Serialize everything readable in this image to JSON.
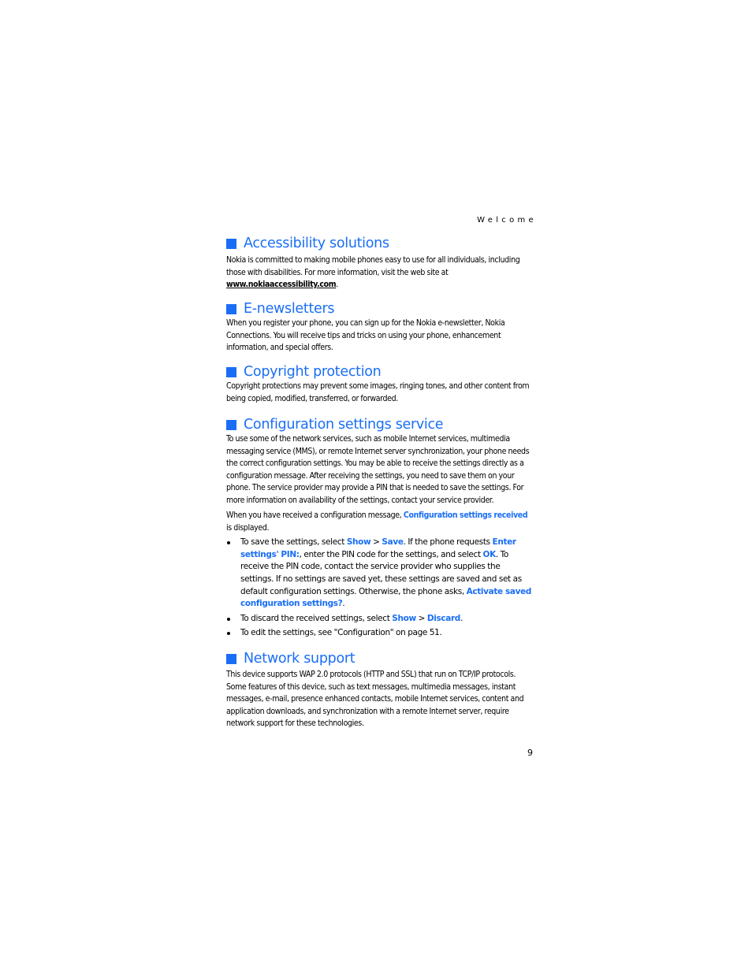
{
  "header": {
    "running_title": "Welcome"
  },
  "accent_color": "#1a6ef5",
  "icons": {
    "section_marker": "blue-square-icon",
    "bullet": "bullet-dot-icon"
  },
  "sections": {
    "accessibility": {
      "title": "Accessibility solutions",
      "text_before_link": "Nokia is committed to making mobile phones easy to use for all individuals, including those with disabilities. For more information, visit the web site at ",
      "link": "www.nokiaaccessibility.com",
      "text_after_link": "."
    },
    "enewsletters": {
      "title": "E-newsletters",
      "text": "When you register your phone, you can sign up for the Nokia e-newsletter, Nokia Connections. You will receive tips and tricks on using your phone, enhancement information, and special offers."
    },
    "copyright": {
      "title": "Copyright protection",
      "text": "Copyright protections may prevent some images, ringing tones, and other content from being copied, modified, transferred, or forwarded."
    },
    "configuration": {
      "title": "Configuration settings service",
      "para1": "To use some of the network services, such as mobile Internet services, multimedia messaging service (MMS), or remote Internet server synchronization, your phone needs the correct configuration settings. You may be able to receive the settings directly as a configuration message. After receiving the settings, you need to save them on your phone. The service provider may provide a PIN that is needed to save the settings. For more information on availability of the settings, contact your service provider.",
      "para2": {
        "before": "When you have received a configuration message, ",
        "highlight": "Configuration settings received",
        "after": " is displayed."
      },
      "bullets": [
        {
          "t1": "To save the settings, select ",
          "k1": "Show",
          "t2": " > ",
          "k2": "Save",
          "t3": ". If the phone requests ",
          "k3": "Enter settings' PIN:",
          "t4": ", enter the PIN code for the settings, and select ",
          "k4": "OK",
          "t5": ". To receive the PIN code, contact the service provider who supplies the settings. If no settings are saved yet, these settings are saved and set as default configuration settings. Otherwise, the phone asks, ",
          "k5": "Activate saved configuration settings?",
          "t6": "."
        },
        {
          "t1": "To discard the received settings, select ",
          "k1": "Show",
          "t2": " > ",
          "k2": "Discard",
          "t3": "."
        },
        {
          "t1": "To edit the settings, see \"Configuration\" on page 51."
        }
      ]
    },
    "network": {
      "title": "Network support",
      "text": "This device supports WAP 2.0 protocols (HTTP and SSL) that run on TCP/IP protocols. Some features of this device, such as text messages, multimedia messages, instant messages, e-mail, presence enhanced contacts, mobile Internet services, content and application downloads, and synchronization with a remote Internet server, require network support for these technologies."
    }
  },
  "footer": {
    "page_number": "9"
  }
}
